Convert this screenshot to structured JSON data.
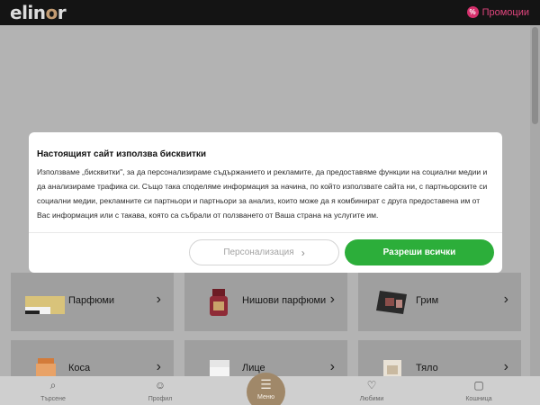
{
  "header": {
    "logo_main": "elin",
    "logo_accent": "o",
    "logo_end": "r",
    "promo_label": "Промоции",
    "promo_icon": "percent-icon"
  },
  "categories": [
    {
      "label": "Парфюми",
      "icon": "perfume-box-icon"
    },
    {
      "label": "Нишови парфюми",
      "icon": "niche-perfume-bottle-icon"
    },
    {
      "label": "Грим",
      "icon": "makeup-palette-icon"
    },
    {
      "label": "Коса",
      "icon": "hair-product-jar-icon"
    },
    {
      "label": "Лице",
      "icon": "face-cream-jar-icon"
    },
    {
      "label": "Тяло",
      "icon": "body-product-icon"
    }
  ],
  "cookie_modal": {
    "title": "Настоящият сайт използва бисквитки",
    "body": "Използваме „бисквитки\", за да персонализираме съдържанието и рекламите, да предоставяме функции на социални медии и да анализираме трафика си. Също така споделяме информация за начина, по който използвате сайта ни, с партньорските си социални медии, рекламните си партньори и партньори за анализ, които може да я комбинират с друга предоставена им от Вас информация или с такава, която са събрали от ползването от Ваша страна на услугите им.",
    "personalize_label": "Персонализация",
    "allow_all_label": "Разреши всички"
  },
  "bottom_nav": {
    "search": "Търсене",
    "profile": "Профил",
    "menu": "Меню",
    "favorites": "Любими",
    "cart": "Кошница"
  },
  "colors": {
    "accent_pink": "#e0457d",
    "allow_green": "#2cae3a",
    "menu_gold": "#a08869",
    "logo_accent": "#c29b72"
  }
}
